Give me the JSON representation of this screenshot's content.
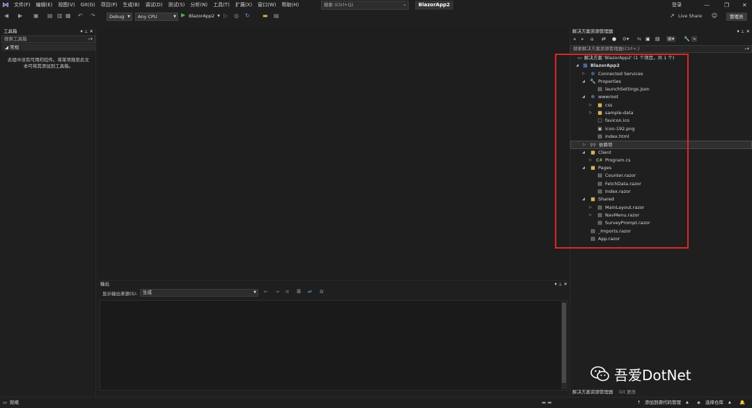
{
  "menubar": {
    "items": [
      "文件(F)",
      "编辑(E)",
      "视图(V)",
      "Git(G)",
      "项目(P)",
      "生成(B)",
      "调试(D)",
      "测试(S)",
      "分析(N)",
      "工具(T)",
      "扩展(X)",
      "窗口(W)",
      "帮助(H)"
    ],
    "search_placeholder": "搜索 (Ctrl+Q)",
    "solution_title": "BlazorApp2",
    "login": "登录"
  },
  "toolbar": {
    "config": "Debug",
    "platform": "Any CPU",
    "start_target": "BlazorApp2",
    "live_share": "Live Share",
    "admin": "管理员"
  },
  "toolbox": {
    "title": "工具箱",
    "search_placeholder": "搜索工具箱",
    "group": "常规",
    "empty_message": "此组中没有可用的控件。将某项拖至此文本可将其添加到工具箱。"
  },
  "output": {
    "title": "输出",
    "source_label": "显示输出来源(S):",
    "source_value": "生成"
  },
  "solution_explorer": {
    "title": "解决方案资源管理器",
    "search_placeholder": "搜索解决方案资源管理器(Ctrl+;)",
    "solution": "解决方案 'BlazorApp2' (1 个项目，共 1 个)",
    "project": "BlazorApp2",
    "nodes": [
      {
        "label": "Connected Services",
        "icon": "connected-services-icon"
      },
      {
        "label": "Properties",
        "icon": "properties-icon"
      },
      {
        "label": "launchSettings.json",
        "icon": "json-file-icon"
      },
      {
        "label": "wwwroot",
        "icon": "globe-icon"
      },
      {
        "label": "css",
        "icon": "folder-icon"
      },
      {
        "label": "sample-data",
        "icon": "folder-icon"
      },
      {
        "label": "favicon.ico",
        "icon": "image-file-icon"
      },
      {
        "label": "icon-192.png",
        "icon": "image-file-icon"
      },
      {
        "label": "index.html",
        "icon": "html-file-icon"
      },
      {
        "label": "依赖项",
        "icon": "dependencies-icon"
      },
      {
        "label": "Client",
        "icon": "folder-icon"
      },
      {
        "label": "Program.cs",
        "icon": "csharp-file-icon"
      },
      {
        "label": "Pages",
        "icon": "folder-icon"
      },
      {
        "label": "Counter.razor",
        "icon": "razor-file-icon"
      },
      {
        "label": "FetchData.razor",
        "icon": "razor-file-icon"
      },
      {
        "label": "Index.razor",
        "icon": "razor-file-icon"
      },
      {
        "label": "Shared",
        "icon": "folder-icon"
      },
      {
        "label": "MainLayout.razor",
        "icon": "razor-file-icon"
      },
      {
        "label": "NavMenu.razor",
        "icon": "razor-file-icon"
      },
      {
        "label": "SurveyPrompt.razor",
        "icon": "razor-file-icon"
      },
      {
        "label": "_Imports.razor",
        "icon": "razor-file-icon"
      },
      {
        "label": "App.razor",
        "icon": "razor-file-icon"
      }
    ],
    "bottom_tabs": [
      "解决方案资源管理器",
      "Git 更改"
    ]
  },
  "statusbar": {
    "ready": "就绪",
    "add_source_control": "添加到源代码管理",
    "select_repo": "选择仓库"
  },
  "watermark": "吾爱DotNet",
  "colors": {
    "highlight_box": "#e0262b",
    "background": "#1f1f1f"
  }
}
